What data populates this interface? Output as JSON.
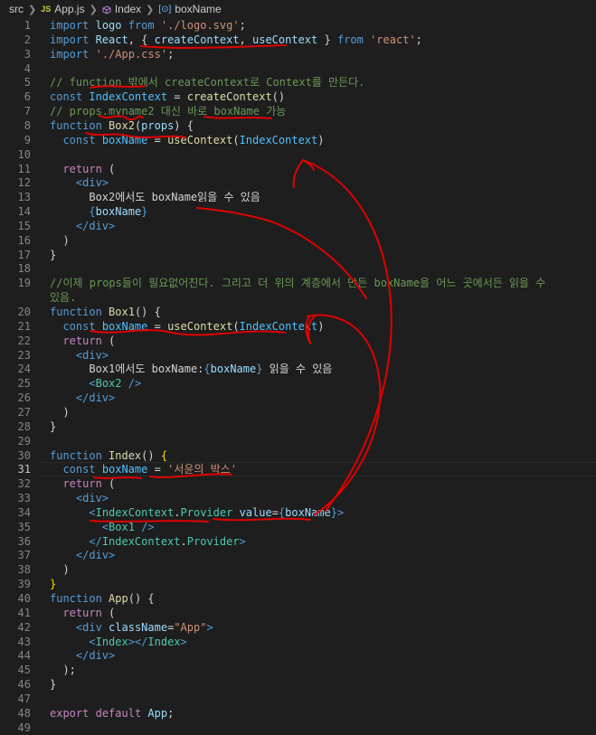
{
  "breadcrumb": {
    "folder": "src",
    "js_badge": "JS",
    "file": "App.js",
    "component": "Index",
    "symbol": "boxName"
  },
  "lines": [
    {
      "n": "1",
      "tokens": [
        [
          "kw",
          "import"
        ],
        [
          "tx",
          " "
        ],
        [
          "vr",
          "logo"
        ],
        [
          "tx",
          " "
        ],
        [
          "kw",
          "from"
        ],
        [
          "tx",
          " "
        ],
        [
          "str",
          "'./logo.svg'"
        ],
        [
          "pn",
          ";"
        ]
      ]
    },
    {
      "n": "2",
      "tokens": [
        [
          "kw",
          "import"
        ],
        [
          "tx",
          " "
        ],
        [
          "vr",
          "React"
        ],
        [
          "pn",
          ", { "
        ],
        [
          "vr",
          "createContext"
        ],
        [
          "pn",
          ", "
        ],
        [
          "vr",
          "useContext"
        ],
        [
          "pn",
          " } "
        ],
        [
          "kw",
          "from"
        ],
        [
          "tx",
          " "
        ],
        [
          "str",
          "'react'"
        ],
        [
          "pn",
          ";"
        ]
      ]
    },
    {
      "n": "3",
      "tokens": [
        [
          "kw",
          "import"
        ],
        [
          "tx",
          " "
        ],
        [
          "str",
          "'./App.css'"
        ],
        [
          "pn",
          ";"
        ]
      ]
    },
    {
      "n": "4",
      "tokens": []
    },
    {
      "n": "5",
      "tokens": [
        [
          "cm",
          "// function 밖에서 createContext로 Context를 만든다."
        ]
      ]
    },
    {
      "n": "6",
      "tokens": [
        [
          "kw",
          "const"
        ],
        [
          "tx",
          " "
        ],
        [
          "cn",
          "IndexContext"
        ],
        [
          "pn",
          " = "
        ],
        [
          "fn",
          "createContext"
        ],
        [
          "pn",
          "()"
        ]
      ]
    },
    {
      "n": "7",
      "tokens": [
        [
          "cm",
          "// props.myname2 대신 바로 boxName 가능"
        ]
      ]
    },
    {
      "n": "8",
      "tokens": [
        [
          "kw",
          "function"
        ],
        [
          "tx",
          " "
        ],
        [
          "fn",
          "Box2"
        ],
        [
          "pn",
          "("
        ],
        [
          "vr",
          "props"
        ],
        [
          "pn",
          ") {"
        ]
      ]
    },
    {
      "n": "9",
      "tokens": [
        [
          "tx",
          "  "
        ],
        [
          "kw",
          "const"
        ],
        [
          "tx",
          " "
        ],
        [
          "cn",
          "boxName"
        ],
        [
          "pn",
          " = "
        ],
        [
          "fn",
          "useContext"
        ],
        [
          "pn",
          "("
        ],
        [
          "cn",
          "IndexContext"
        ],
        [
          "pn",
          ")"
        ]
      ]
    },
    {
      "n": "10",
      "tokens": []
    },
    {
      "n": "11",
      "tokens": [
        [
          "tx",
          "  "
        ],
        [
          "ctl",
          "return"
        ],
        [
          "pn",
          " ("
        ]
      ]
    },
    {
      "n": "12",
      "tokens": [
        [
          "tx",
          "    "
        ],
        [
          "tg",
          "<div>"
        ]
      ]
    },
    {
      "n": "13",
      "tokens": [
        [
          "tx",
          "      "
        ],
        [
          "tx",
          "Box2에서도 boxName읽을 수 있음"
        ]
      ]
    },
    {
      "n": "14",
      "tokens": [
        [
          "tx",
          "      "
        ],
        [
          "tg",
          "{"
        ],
        [
          "vr",
          "boxName"
        ],
        [
          "tg",
          "}"
        ]
      ]
    },
    {
      "n": "15",
      "tokens": [
        [
          "tx",
          "    "
        ],
        [
          "tg",
          "</div>"
        ]
      ]
    },
    {
      "n": "16",
      "tokens": [
        [
          "tx",
          "  "
        ],
        [
          "pn",
          ")"
        ]
      ]
    },
    {
      "n": "17",
      "tokens": [
        [
          "pn",
          "}"
        ]
      ]
    },
    {
      "n": "18",
      "tokens": []
    },
    {
      "n": "19",
      "tokens": [
        [
          "cm",
          "//이제 props들이 필요없어진다. 그리고 더 위의 계층에서 만든 boxName을 어느 곳에서든 읽을 수"
        ]
      ]
    },
    {
      "n": "",
      "tokens": [
        [
          "cm",
          "있음."
        ]
      ]
    },
    {
      "n": "20",
      "tokens": [
        [
          "kw",
          "function"
        ],
        [
          "tx",
          " "
        ],
        [
          "fn",
          "Box1"
        ],
        [
          "pn",
          "() {"
        ]
      ]
    },
    {
      "n": "21",
      "tokens": [
        [
          "tx",
          "  "
        ],
        [
          "kw",
          "const"
        ],
        [
          "tx",
          " "
        ],
        [
          "cn",
          "boxName"
        ],
        [
          "pn",
          " = "
        ],
        [
          "fn",
          "useContext"
        ],
        [
          "pn",
          "("
        ],
        [
          "cn",
          "IndexContext"
        ],
        [
          "pn",
          ")"
        ]
      ]
    },
    {
      "n": "22",
      "tokens": [
        [
          "tx",
          "  "
        ],
        [
          "ctl",
          "return"
        ],
        [
          "pn",
          " ("
        ]
      ]
    },
    {
      "n": "23",
      "tokens": [
        [
          "tx",
          "    "
        ],
        [
          "tg",
          "<div>"
        ]
      ]
    },
    {
      "n": "24",
      "tokens": [
        [
          "tx",
          "      "
        ],
        [
          "tx",
          "Box1에서도 boxName:"
        ],
        [
          "tg",
          "{"
        ],
        [
          "vr",
          "boxName"
        ],
        [
          "tg",
          "}"
        ],
        [
          "tx",
          " 읽을 수 있음"
        ]
      ]
    },
    {
      "n": "25",
      "tokens": [
        [
          "tx",
          "      "
        ],
        [
          "tg",
          "<"
        ],
        [
          "cp",
          "Box2"
        ],
        [
          "tg",
          " />"
        ]
      ]
    },
    {
      "n": "26",
      "tokens": [
        [
          "tx",
          "    "
        ],
        [
          "tg",
          "</div>"
        ]
      ]
    },
    {
      "n": "27",
      "tokens": [
        [
          "tx",
          "  "
        ],
        [
          "pn",
          ")"
        ]
      ]
    },
    {
      "n": "28",
      "tokens": [
        [
          "pn",
          "}"
        ]
      ]
    },
    {
      "n": "29",
      "tokens": []
    },
    {
      "n": "30",
      "tokens": [
        [
          "kw",
          "function"
        ],
        [
          "tx",
          " "
        ],
        [
          "fn",
          "Index"
        ],
        [
          "pn",
          "() "
        ],
        [
          "br",
          "{"
        ]
      ]
    },
    {
      "n": "31",
      "active": true,
      "tokens": [
        [
          "tx",
          "  "
        ],
        [
          "kw",
          "const"
        ],
        [
          "tx",
          " "
        ],
        [
          "cn",
          "boxName"
        ],
        [
          "pn",
          " = "
        ],
        [
          "str",
          "'서윤의 박스'"
        ]
      ]
    },
    {
      "n": "32",
      "tokens": [
        [
          "tx",
          "  "
        ],
        [
          "ctl",
          "return"
        ],
        [
          "pn",
          " ("
        ]
      ]
    },
    {
      "n": "33",
      "tokens": [
        [
          "tx",
          "    "
        ],
        [
          "tg",
          "<div>"
        ]
      ]
    },
    {
      "n": "34",
      "tokens": [
        [
          "tx",
          "      "
        ],
        [
          "tg",
          "<"
        ],
        [
          "cp",
          "IndexContext"
        ],
        [
          "pn",
          "."
        ],
        [
          "cp",
          "Provider"
        ],
        [
          "tx",
          " "
        ],
        [
          "at",
          "value"
        ],
        [
          "pn",
          "="
        ],
        [
          "tg",
          "{"
        ],
        [
          "vr",
          "boxName"
        ],
        [
          "tg",
          "}"
        ],
        [
          "tg",
          ">"
        ]
      ]
    },
    {
      "n": "35",
      "tokens": [
        [
          "tx",
          "        "
        ],
        [
          "tg",
          "<"
        ],
        [
          "cp",
          "Box1"
        ],
        [
          "tg",
          " />"
        ]
      ]
    },
    {
      "n": "36",
      "tokens": [
        [
          "tx",
          "      "
        ],
        [
          "tg",
          "</"
        ],
        [
          "cp",
          "IndexContext"
        ],
        [
          "pn",
          "."
        ],
        [
          "cp",
          "Provider"
        ],
        [
          "tg",
          ">"
        ]
      ]
    },
    {
      "n": "37",
      "tokens": [
        [
          "tx",
          "    "
        ],
        [
          "tg",
          "</div>"
        ]
      ]
    },
    {
      "n": "38",
      "tokens": [
        [
          "tx",
          "  "
        ],
        [
          "pn",
          ")"
        ]
      ]
    },
    {
      "n": "39",
      "tokens": [
        [
          "br",
          "}"
        ]
      ]
    },
    {
      "n": "40",
      "tokens": [
        [
          "kw",
          "function"
        ],
        [
          "tx",
          " "
        ],
        [
          "fn",
          "App"
        ],
        [
          "pn",
          "() {"
        ]
      ]
    },
    {
      "n": "41",
      "tokens": [
        [
          "tx",
          "  "
        ],
        [
          "ctl",
          "return"
        ],
        [
          "pn",
          " ("
        ]
      ]
    },
    {
      "n": "42",
      "tokens": [
        [
          "tx",
          "    "
        ],
        [
          "tg",
          "<div"
        ],
        [
          "tx",
          " "
        ],
        [
          "at",
          "className"
        ],
        [
          "pn",
          "="
        ],
        [
          "str",
          "\"App\""
        ],
        [
          "tg",
          ">"
        ]
      ]
    },
    {
      "n": "43",
      "tokens": [
        [
          "tx",
          "      "
        ],
        [
          "tg",
          "<"
        ],
        [
          "cp",
          "Index"
        ],
        [
          "tg",
          "></"
        ],
        [
          "cp",
          "Index"
        ],
        [
          "tg",
          ">"
        ]
      ]
    },
    {
      "n": "44",
      "tokens": [
        [
          "tx",
          "    "
        ],
        [
          "tg",
          "</div>"
        ]
      ]
    },
    {
      "n": "45",
      "tokens": [
        [
          "tx",
          "  "
        ],
        [
          "pn",
          ");"
        ]
      ]
    },
    {
      "n": "46",
      "tokens": [
        [
          "pn",
          "}"
        ]
      ]
    },
    {
      "n": "47",
      "tokens": []
    },
    {
      "n": "48",
      "tokens": [
        [
          "ctl",
          "export"
        ],
        [
          "tx",
          " "
        ],
        [
          "ctl",
          "default"
        ],
        [
          "tx",
          " "
        ],
        [
          "vr",
          "App"
        ],
        [
          "pn",
          ";"
        ]
      ]
    },
    {
      "n": "49",
      "tokens": []
    }
  ]
}
